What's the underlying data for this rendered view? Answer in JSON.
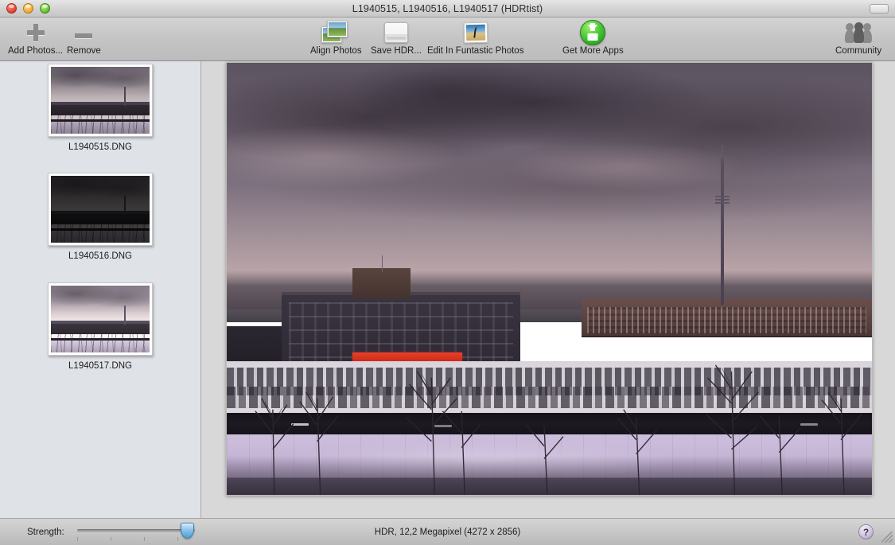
{
  "window": {
    "title": "L1940515, L1940516, L1940517 (HDRtist)",
    "traffic_lights": [
      "close",
      "minimize",
      "zoom"
    ]
  },
  "toolbar": {
    "items": [
      {
        "label": "Add Photos...",
        "icon": "plus-icon"
      },
      {
        "label": "Remove",
        "icon": "minus-icon"
      },
      {
        "label": "Align Photos",
        "icon": "stacked-photos-icon"
      },
      {
        "label": "Save HDR...",
        "icon": "hard-drive-icon"
      },
      {
        "label": "Edit In Funtastic Photos",
        "icon": "photo-edit-icon"
      },
      {
        "label": "Get More Apps",
        "icon": "green-download-icon"
      },
      {
        "label": "Community",
        "icon": "people-icon"
      }
    ]
  },
  "sidebar": {
    "thumbnails": [
      {
        "caption": "L1940515.DNG",
        "exposure": "normal"
      },
      {
        "caption": "L1940516.DNG",
        "exposure": "dark"
      },
      {
        "caption": "L1940517.DNG",
        "exposure": "bright"
      }
    ]
  },
  "statusbar": {
    "strength_label": "Strength:",
    "strength_value": 93,
    "info": "HDR, 12,2 Megapixel (4272 x 2856)",
    "help_label": "?"
  },
  "colors": {
    "sidebar_bg": "#dfe3e8",
    "toolbar_bg": "#c4c4c4",
    "accent_red": "#e8412a",
    "slider_blue": "#4f9ed6",
    "green_badge": "#3fc030"
  }
}
